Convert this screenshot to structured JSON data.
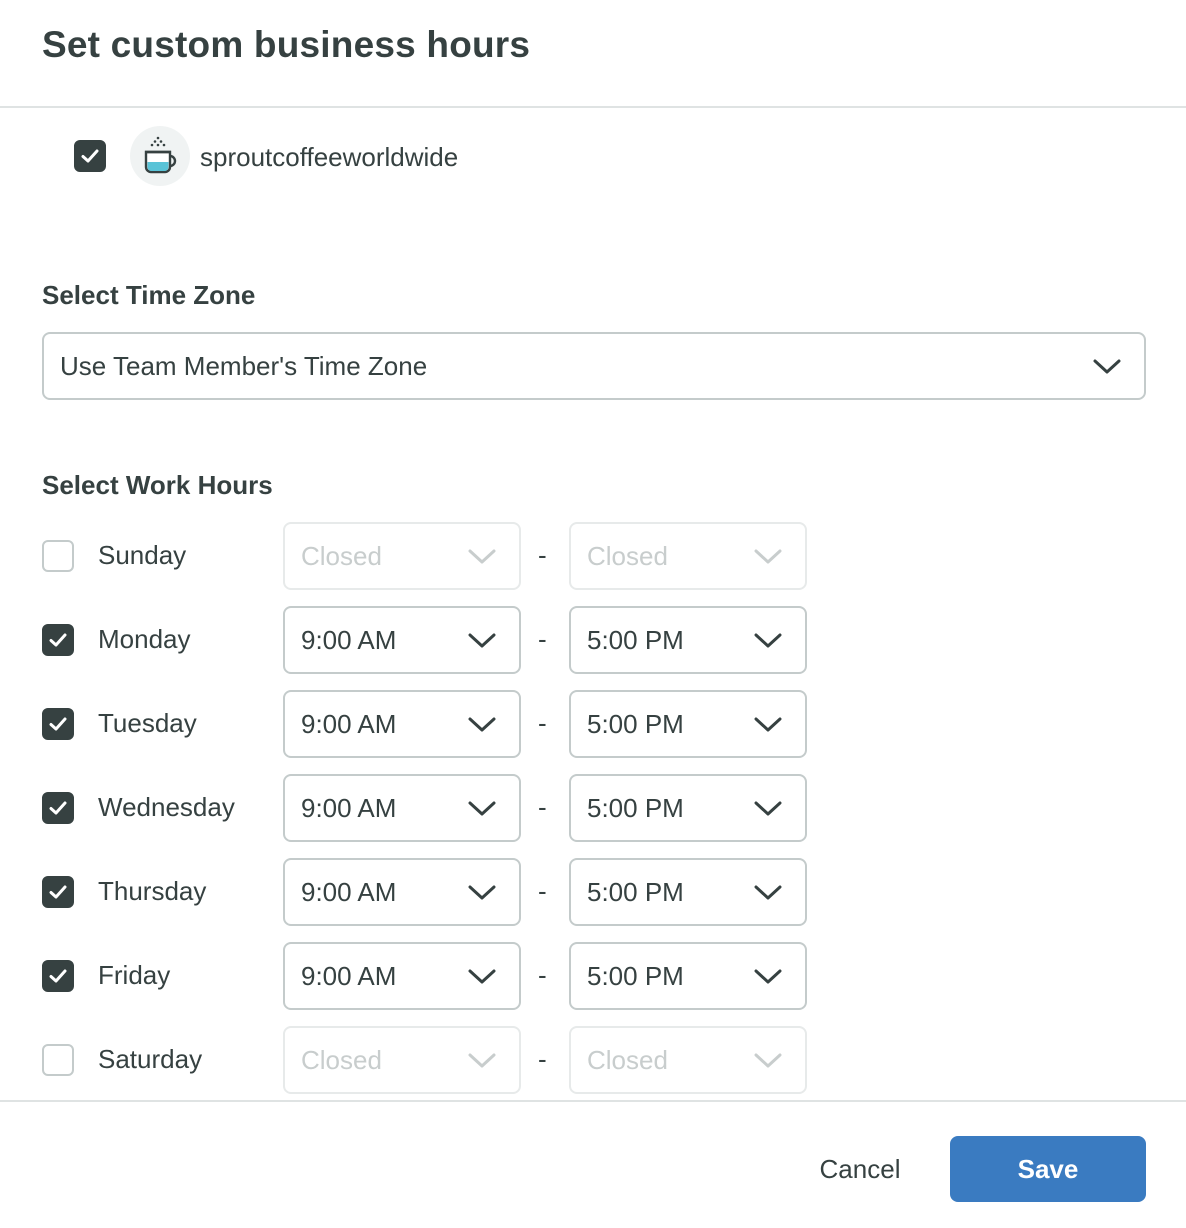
{
  "modal": {
    "title": "Set custom business hours"
  },
  "profile": {
    "name": "sproutcoffeeworldwide",
    "checked": true,
    "avatar_icon": "coffee-cup-icon"
  },
  "timezone": {
    "label": "Select Time Zone",
    "value": "Use Team Member's Time Zone"
  },
  "work_hours": {
    "label": "Select Work Hours",
    "separator": "-",
    "days": [
      {
        "name": "Sunday",
        "checked": false,
        "start": "Closed",
        "end": "Closed"
      },
      {
        "name": "Monday",
        "checked": true,
        "start": "9:00 AM",
        "end": "5:00 PM"
      },
      {
        "name": "Tuesday",
        "checked": true,
        "start": "9:00 AM",
        "end": "5:00 PM"
      },
      {
        "name": "Wednesday",
        "checked": true,
        "start": "9:00 AM",
        "end": "5:00 PM"
      },
      {
        "name": "Thursday",
        "checked": true,
        "start": "9:00 AM",
        "end": "5:00 PM"
      },
      {
        "name": "Friday",
        "checked": true,
        "start": "9:00 AM",
        "end": "5:00 PM"
      },
      {
        "name": "Saturday",
        "checked": false,
        "start": "Closed",
        "end": "Closed"
      }
    ]
  },
  "footer": {
    "cancel_label": "Cancel",
    "save_label": "Save"
  },
  "colors": {
    "text": "#364141",
    "border": "#c4cbcb",
    "primary": "#3a7bc1",
    "checkbox_on": "#364141"
  }
}
